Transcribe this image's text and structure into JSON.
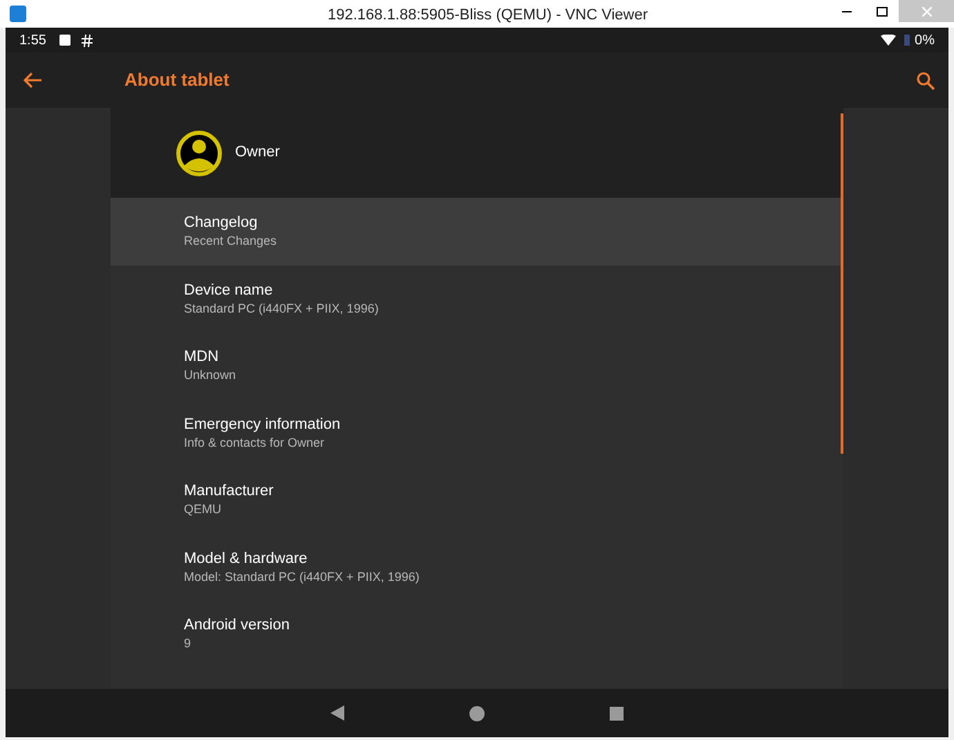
{
  "window": {
    "title": "192.168.1.88:5905-Bliss (QEMU) - VNC Viewer"
  },
  "status_bar": {
    "time": "1:55",
    "battery": "0%"
  },
  "app_bar": {
    "title": "About tablet"
  },
  "owner": {
    "name": "Owner"
  },
  "items": [
    {
      "title": "Changelog",
      "summary": "Recent Changes",
      "selected": true
    },
    {
      "title": "Device name",
      "summary": "Standard PC (i440FX + PIIX, 1996)",
      "selected": false
    },
    {
      "title": "MDN",
      "summary": "Unknown",
      "selected": false
    },
    {
      "title": "Emergency information",
      "summary": "Info & contacts for Owner",
      "selected": false
    },
    {
      "title": "Manufacturer",
      "summary": "QEMU",
      "selected": false
    },
    {
      "title": "Model & hardware",
      "summary": "Model: Standard PC (i440FX + PIIX, 1996)",
      "selected": false
    },
    {
      "title": "Android version",
      "summary": "9",
      "selected": false
    }
  ]
}
